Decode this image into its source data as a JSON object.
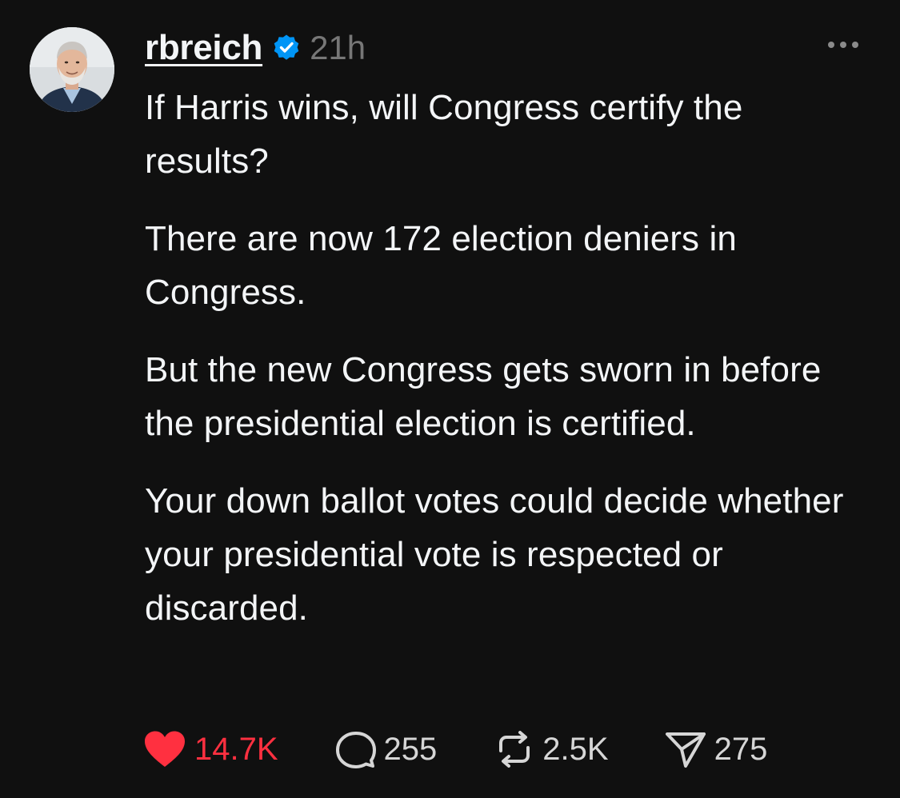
{
  "post": {
    "author": {
      "username": "rbreich",
      "verified": true,
      "avatar_icon": "profile-photo"
    },
    "timestamp": "21h",
    "more_icon": "ellipsis-icon",
    "paragraphs": [
      "If Harris wins, will Congress certify the results?",
      "There are now 172 election deniers in Congress.",
      "But the new Congress gets sworn in before the presidential election is certified.",
      "Your down ballot votes could decide whether your presidential vote is respected or discarded."
    ],
    "actions": {
      "likes": "14.7K",
      "replies": "255",
      "reposts": "2.5K",
      "shares": "275"
    }
  },
  "colors": {
    "background": "#101010",
    "text": "#f3f5f7",
    "muted": "#777777",
    "like_red": "#ff3040",
    "verified_blue": "#0095f6"
  }
}
